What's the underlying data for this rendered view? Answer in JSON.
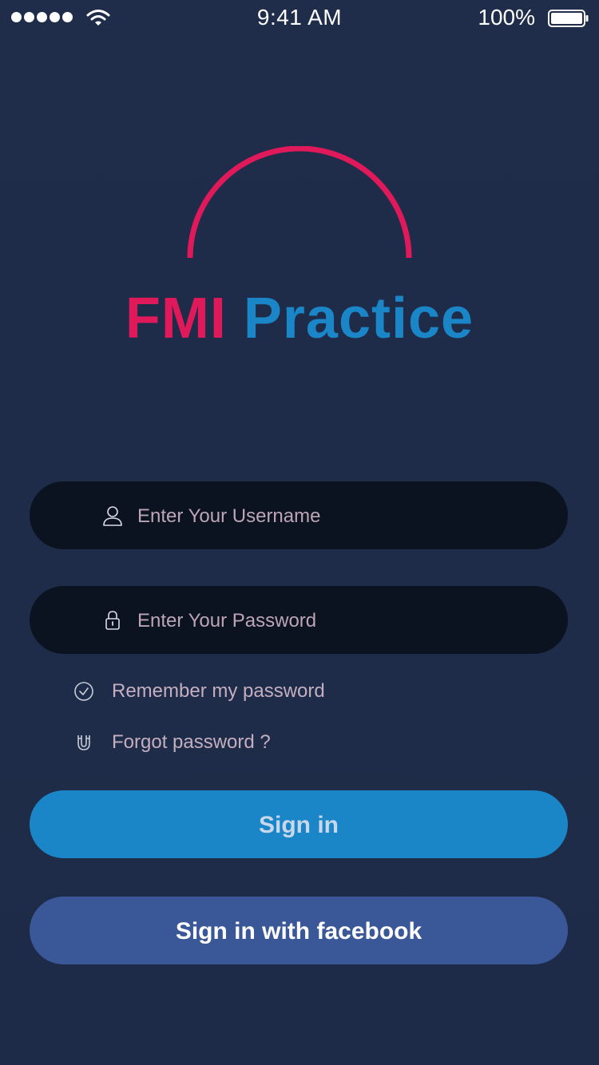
{
  "status_bar": {
    "time": "9:41 AM",
    "battery_percent": "100%",
    "signal_icon": "signal-dots-icon",
    "wifi_icon": "wifi-icon",
    "battery_icon": "battery-icon"
  },
  "logo": {
    "word1": "FMI",
    "word2": "Practice",
    "colors": {
      "word1": "#e0195a",
      "word2": "#1a86c8",
      "arc": "#e0195a"
    }
  },
  "form": {
    "username": {
      "value": "",
      "placeholder": "Enter Your Username",
      "icon": "user-icon"
    },
    "password": {
      "value": "",
      "placeholder": "Enter Your Password",
      "icon": "lock-icon"
    },
    "remember": {
      "label": "Remember my password",
      "icon": "check-circle-icon"
    },
    "forgot": {
      "label": "Forgot password ?",
      "icon": "magnet-icon"
    }
  },
  "buttons": {
    "signin": "Sign in",
    "facebook": "Sign in with facebook"
  },
  "colors": {
    "background": "#1e2a45",
    "input_bg": "#0c1320",
    "signin_bg": "#1a86c8",
    "facebook_bg": "#3a5797"
  }
}
